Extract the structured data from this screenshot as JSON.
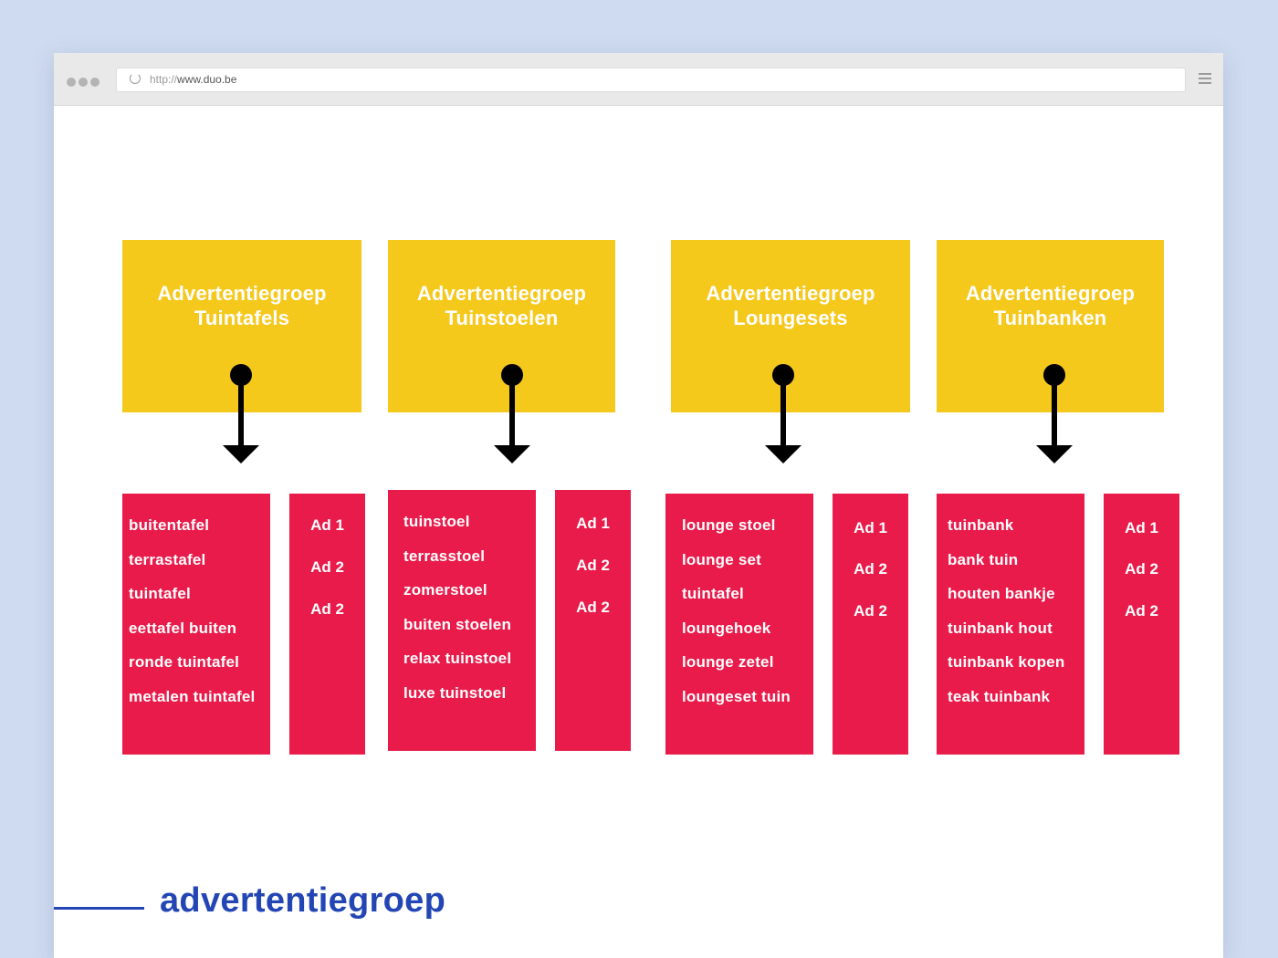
{
  "browser": {
    "url_prefix": "http://",
    "url_host": "www.duo.be"
  },
  "colors": {
    "page_background": "#cfdbf0",
    "group_yellow": "#f5c81c",
    "keyword_red": "#e81b4b",
    "legend_blue": "#2346b4"
  },
  "groups": [
    {
      "title_line1": "Advertentiegroep",
      "title_line2": "Tuintafels",
      "keywords": [
        "buitentafel",
        "terrastafel",
        "tuintafel",
        "eettafel buiten",
        "ronde tuintafel",
        "metalen tuintafel"
      ],
      "ads": [
        "Ad 1",
        "Ad 2",
        "Ad 2"
      ]
    },
    {
      "title_line1": "Advertentiegroep",
      "title_line2": "Tuinstoelen",
      "keywords": [
        "tuinstoel",
        "terrasstoel",
        "zomerstoel",
        "buiten stoelen",
        "relax tuinstoel",
        "luxe tuinstoel"
      ],
      "ads": [
        "Ad 1",
        "Ad 2",
        "Ad 2"
      ]
    },
    {
      "title_line1": "Advertentiegroep",
      "title_line2": "Loungesets",
      "keywords": [
        "lounge stoel",
        "lounge set",
        "tuintafel",
        "loungehoek",
        "lounge zetel",
        "loungeset tuin"
      ],
      "ads": [
        "Ad 1",
        "Ad 2",
        "Ad 2"
      ]
    },
    {
      "title_line1": "Advertentiegroep",
      "title_line2": "Tuinbanken",
      "keywords": [
        "tuinbank",
        "bank tuin",
        "houten bankje",
        "tuinbank hout",
        "tuinbank kopen",
        "teak tuinbank"
      ],
      "ads": [
        "Ad 1",
        "Ad 2",
        "Ad 2"
      ]
    }
  ],
  "legend": {
    "label": "advertentiegroep"
  }
}
